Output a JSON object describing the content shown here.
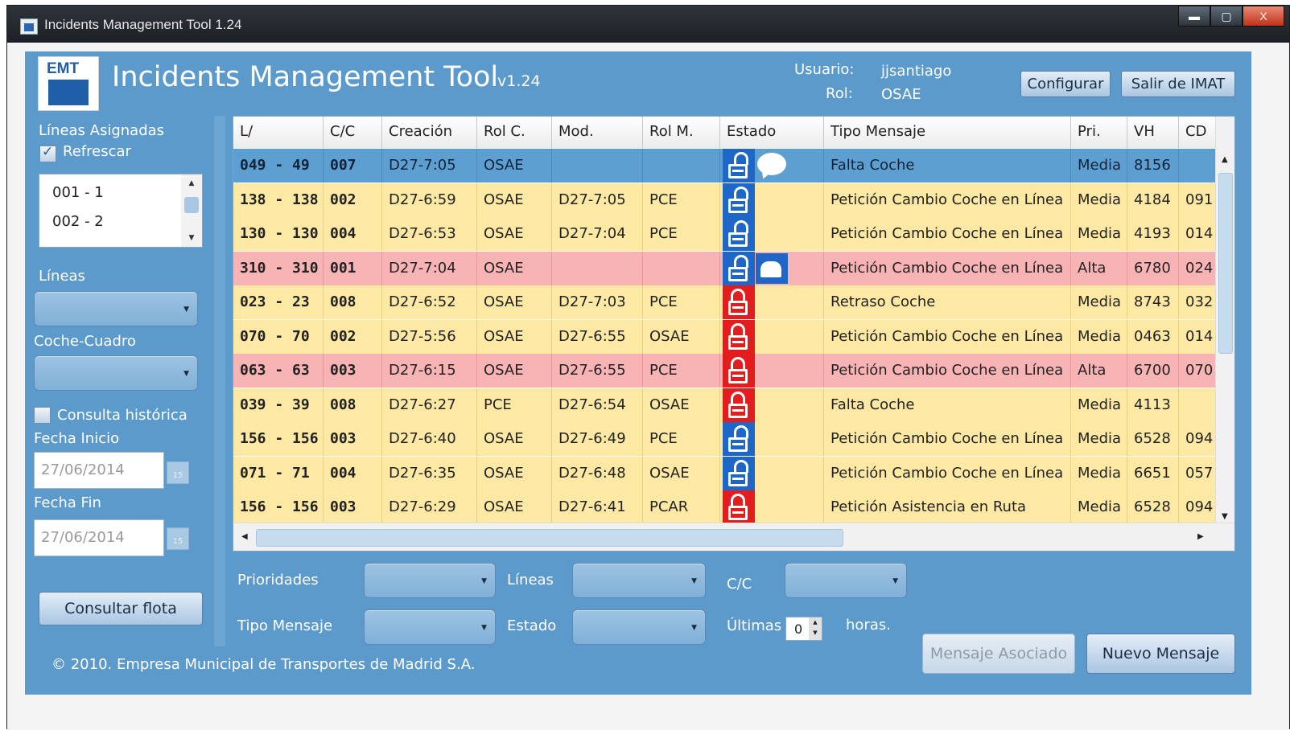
{
  "window": {
    "title": "Incidents Management Tool 1.24",
    "minimize": "▬",
    "maximize": "▢",
    "close": "X"
  },
  "header": {
    "logo_text": "EMT",
    "title": "Incidents Management Tool",
    "version": "v1.24",
    "user_label": "Usuario:",
    "user_value": "jjsantiago",
    "role_label": "Rol:",
    "role_value": "OSAE",
    "configure_button": "Configurar",
    "exit_button": "Salir de IMAT"
  },
  "left_panel": {
    "assigned_lines_label": "Líneas Asignadas",
    "refresh_label": "Refrescar",
    "refresh_checked": true,
    "assigned_lines": [
      "001 - 1",
      "002 - 2"
    ],
    "lines_label": "Líneas",
    "lines_value": "",
    "car_label": "Coche-Cuadro",
    "car_value": "",
    "historic_label": "Consulta histórica",
    "historic_checked": false,
    "start_date_label": "Fecha Inicio",
    "start_date_value": "27/06/2014",
    "end_date_label": "Fecha Fin",
    "end_date_value": "27/06/2014",
    "calendar_glyph": "15",
    "fleet_button": "Consultar flota"
  },
  "grid": {
    "columns": [
      "L/",
      "C/C",
      "Creación",
      "Rol C.",
      "Mod.",
      "Rol M.",
      "Estado",
      "Tipo Mensaje",
      "Pri.",
      "VH",
      "CD"
    ],
    "rows": [
      {
        "line": "049 - 49",
        "cc": "007",
        "created": "D27-7:05",
        "role_c": "OSAE",
        "mod": "",
        "role_m": "",
        "lock": "open",
        "extra": "speech",
        "type": "Falta Coche",
        "pri": "Media",
        "vh": "8156",
        "cd": "",
        "color": "selected"
      },
      {
        "line": "138 - 138",
        "cc": "002",
        "created": "D27-6:59",
        "role_c": "OSAE",
        "mod": "D27-7:05",
        "role_m": "PCE",
        "lock": "open",
        "extra": "",
        "type": "Petición Cambio Coche en Línea",
        "pri": "Media",
        "vh": "4184",
        "cd": "091",
        "color": "yellow"
      },
      {
        "line": "130 - 130",
        "cc": "004",
        "created": "D27-6:53",
        "role_c": "OSAE",
        "mod": "D27-7:04",
        "role_m": "PCE",
        "lock": "open",
        "extra": "",
        "type": "Petición Cambio Coche en Línea",
        "pri": "Media",
        "vh": "4193",
        "cd": "014",
        "color": "yellow"
      },
      {
        "line": "310 - 310",
        "cc": "001",
        "created": "D27-7:04",
        "role_c": "OSAE",
        "mod": "",
        "role_m": "",
        "lock": "open",
        "extra": "mail",
        "type": "Petición Cambio Coche en Línea",
        "pri": "Alta",
        "vh": "6780",
        "cd": "024",
        "color": "pink"
      },
      {
        "line": "023 - 23",
        "cc": "008",
        "created": "D27-6:52",
        "role_c": "OSAE",
        "mod": "D27-7:03",
        "role_m": "PCE",
        "lock": "closed",
        "extra": "",
        "type": "Retraso Coche",
        "pri": "Media",
        "vh": "8743",
        "cd": "032",
        "color": "yellow"
      },
      {
        "line": "070 - 70",
        "cc": "002",
        "created": "D27-5:56",
        "role_c": "OSAE",
        "mod": "D27-6:55",
        "role_m": "OSAE",
        "lock": "closed",
        "extra": "",
        "type": "Petición Cambio Coche en Línea",
        "pri": "Media",
        "vh": "0463",
        "cd": "014",
        "color": "yellow"
      },
      {
        "line": "063 - 63",
        "cc": "003",
        "created": "D27-6:15",
        "role_c": "OSAE",
        "mod": "D27-6:55",
        "role_m": "PCE",
        "lock": "closed",
        "extra": "",
        "type": "Petición Cambio Coche en Línea",
        "pri": "Alta",
        "vh": "6700",
        "cd": "070",
        "color": "pink"
      },
      {
        "line": "039 - 39",
        "cc": "008",
        "created": "D27-6:27",
        "role_c": "PCE",
        "mod": "D27-6:54",
        "role_m": "OSAE",
        "lock": "closed",
        "extra": "",
        "type": "Falta Coche",
        "pri": "Media",
        "vh": "4113",
        "cd": "",
        "color": "yellow"
      },
      {
        "line": "156 - 156",
        "cc": "003",
        "created": "D27-6:40",
        "role_c": "OSAE",
        "mod": "D27-6:49",
        "role_m": "PCE",
        "lock": "open",
        "extra": "",
        "type": "Petición Cambio Coche en Línea",
        "pri": "Media",
        "vh": "6528",
        "cd": "094",
        "color": "yellow"
      },
      {
        "line": "071 - 71",
        "cc": "004",
        "created": "D27-6:35",
        "role_c": "OSAE",
        "mod": "D27-6:48",
        "role_m": "OSAE",
        "lock": "open",
        "extra": "",
        "type": "Petición Cambio Coche en Línea",
        "pri": "Media",
        "vh": "6651",
        "cd": "057",
        "color": "yellow"
      },
      {
        "line": "156 - 156",
        "cc": "003",
        "created": "D27-6:29",
        "role_c": "OSAE",
        "mod": "D27-6:41",
        "role_m": "PCAR",
        "lock": "closed",
        "extra": "",
        "type": "Petición Asistencia en Ruta",
        "pri": "Media",
        "vh": "6528",
        "cd": "094",
        "color": "yellow"
      }
    ]
  },
  "filters": {
    "priorities_label": "Prioridades",
    "lines_label": "Líneas",
    "cc_label": "C/C",
    "message_type_label": "Tipo Mensaje",
    "status_label": "Estado",
    "last_label": "Últimas",
    "last_value": "0",
    "hours_label": "horas."
  },
  "actions": {
    "associated_message_button": "Mensaje Asociado",
    "new_message_button": "Nuevo Mensaje"
  },
  "footer": {
    "copyright": "© 2010. Empresa Municipal de Transportes de Madrid S.A."
  },
  "colors": {
    "panel": "#5c9acb",
    "row_yellow": "#fde9a4",
    "row_pink": "#f8b4b5",
    "row_selected": "#5e9fd2",
    "lock_open": "#1f66c9",
    "lock_closed": "#e31d1d"
  }
}
